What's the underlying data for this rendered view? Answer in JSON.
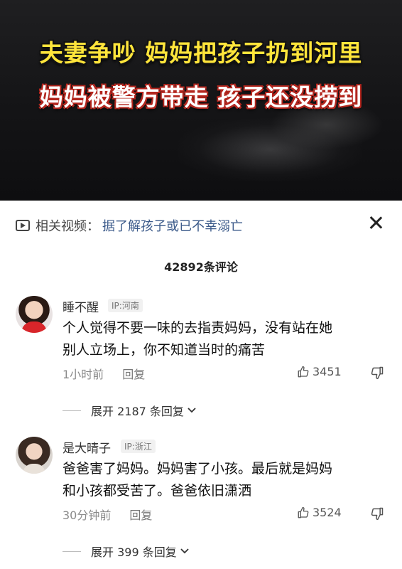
{
  "video": {
    "caption_line1": "夫妻争吵 妈妈把孩子扔到河里",
    "caption_line2": "妈妈被警方带走 孩子还没捞到"
  },
  "related": {
    "label": "相关视频：",
    "link": "据了解孩子或已不幸溺亡"
  },
  "comments_count": "42892条评论",
  "comments": [
    {
      "username": "睡不醒",
      "ip": "IP:河南",
      "line1": "个人觉得不要一味的去指责妈妈，没有站在她",
      "line2": "别人立场上，你不知道当时的痛苦",
      "time": "1小时前",
      "reply": "回复",
      "likes": "3451",
      "expand": "展开 2187 条回复"
    },
    {
      "username": "是大晴子",
      "ip": "IP:浙江",
      "line1": "爸爸害了妈妈。妈妈害了小孩。最后就是妈妈",
      "line2": "和小孩都受苦了。爸爸依旧潇洒",
      "time": "30分钟前",
      "reply": "回复",
      "likes": "3524",
      "expand": "展开 399 条回复"
    }
  ],
  "colors": {
    "caption1": "#ffe53b",
    "caption2": "#ffffff",
    "caption2_outline": "#b3261e",
    "related_link": "#3b5a8a"
  }
}
